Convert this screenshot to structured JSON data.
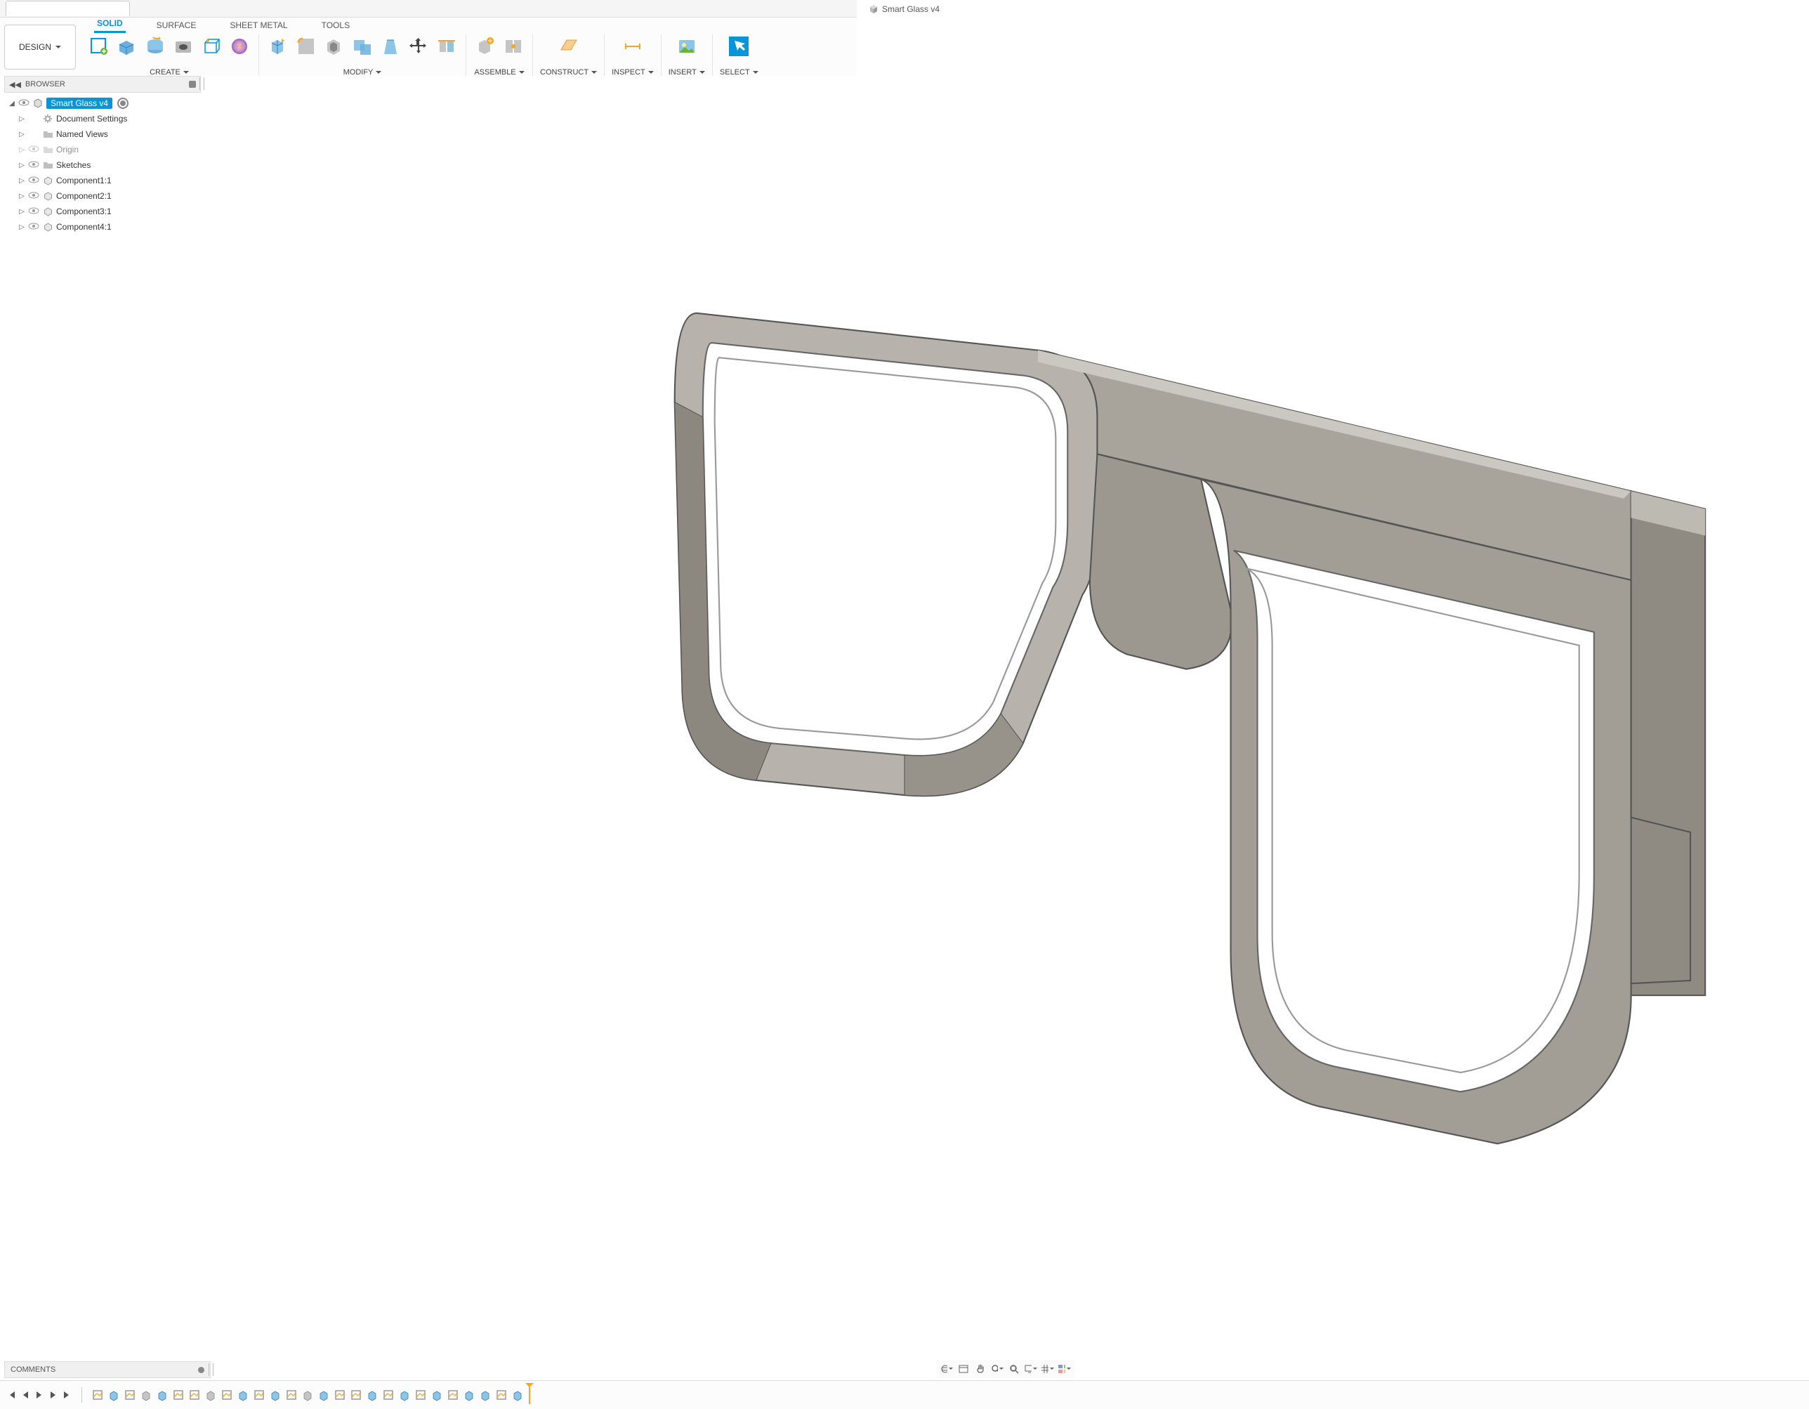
{
  "qat": {
    "items": [
      "grid",
      "file",
      "save",
      "undo",
      "redo"
    ]
  },
  "document": {
    "title": "Smart Glass v4"
  },
  "workspace": {
    "button": "DESIGN"
  },
  "tabs": {
    "items": [
      "SOLID",
      "SURFACE",
      "SHEET METAL",
      "TOOLS"
    ],
    "active": 0
  },
  "groups": {
    "create": "CREATE",
    "modify": "MODIFY",
    "assemble": "ASSEMBLE",
    "construct": "CONSTRUCT",
    "inspect": "INSPECT",
    "insert": "INSERT",
    "select": "SELECT"
  },
  "browser": {
    "title": "BROWSER",
    "root": "Smart Glass v4",
    "items": [
      {
        "label": "Document Settings",
        "icon": "gear",
        "eye": false
      },
      {
        "label": "Named Views",
        "icon": "folder",
        "eye": false
      },
      {
        "label": "Origin",
        "icon": "folder",
        "eye": true,
        "dim": true
      },
      {
        "label": "Sketches",
        "icon": "folder",
        "eye": true
      },
      {
        "label": "Component1:1",
        "icon": "comp",
        "eye": true
      },
      {
        "label": "Component2:1",
        "icon": "comp",
        "eye": true
      },
      {
        "label": "Component3:1",
        "icon": "comp",
        "eye": true
      },
      {
        "label": "Component4:1",
        "icon": "comp",
        "eye": true
      }
    ]
  },
  "comments": {
    "title": "COMMENTS"
  },
  "timeline": {
    "count": 27
  }
}
